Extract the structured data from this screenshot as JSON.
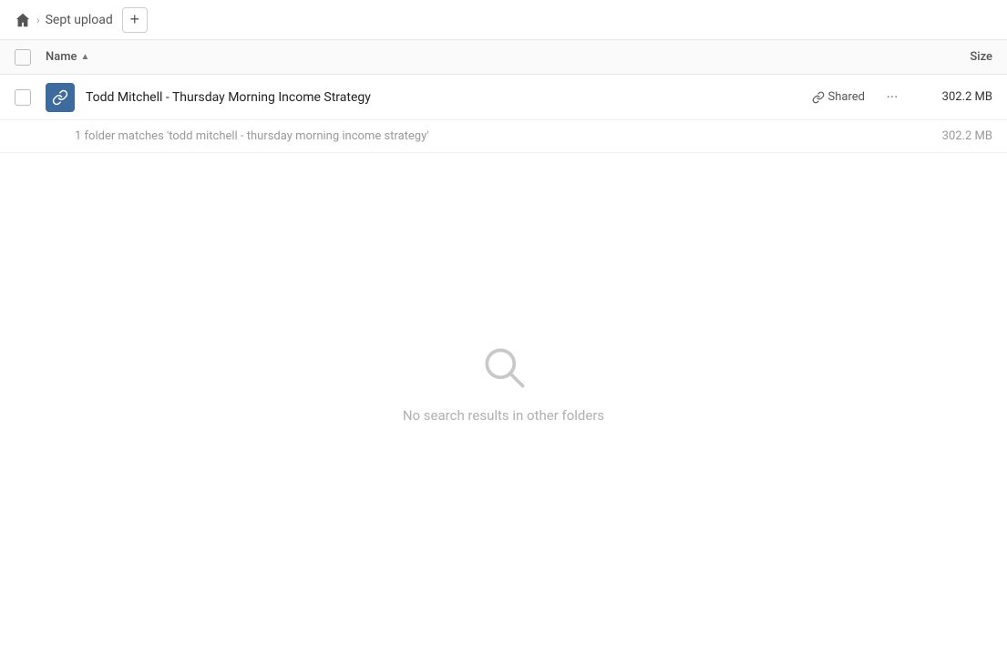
{
  "breadcrumb": {
    "home_label": "Home",
    "folder_name": "Sept upload",
    "add_button_label": "+"
  },
  "table": {
    "col_name": "Name",
    "col_sort_arrow": "▲",
    "col_size": "Size"
  },
  "file_row": {
    "name": "Todd Mitchell - Thursday Morning Income Strategy",
    "shared_label": "Shared",
    "more_label": "...",
    "size": "302.2 MB"
  },
  "summary": {
    "match_text": "1 folder matches 'todd mitchell - thursday morning income strategy'",
    "size": "302.2 MB"
  },
  "empty_state": {
    "text": "No search results in other folders"
  }
}
